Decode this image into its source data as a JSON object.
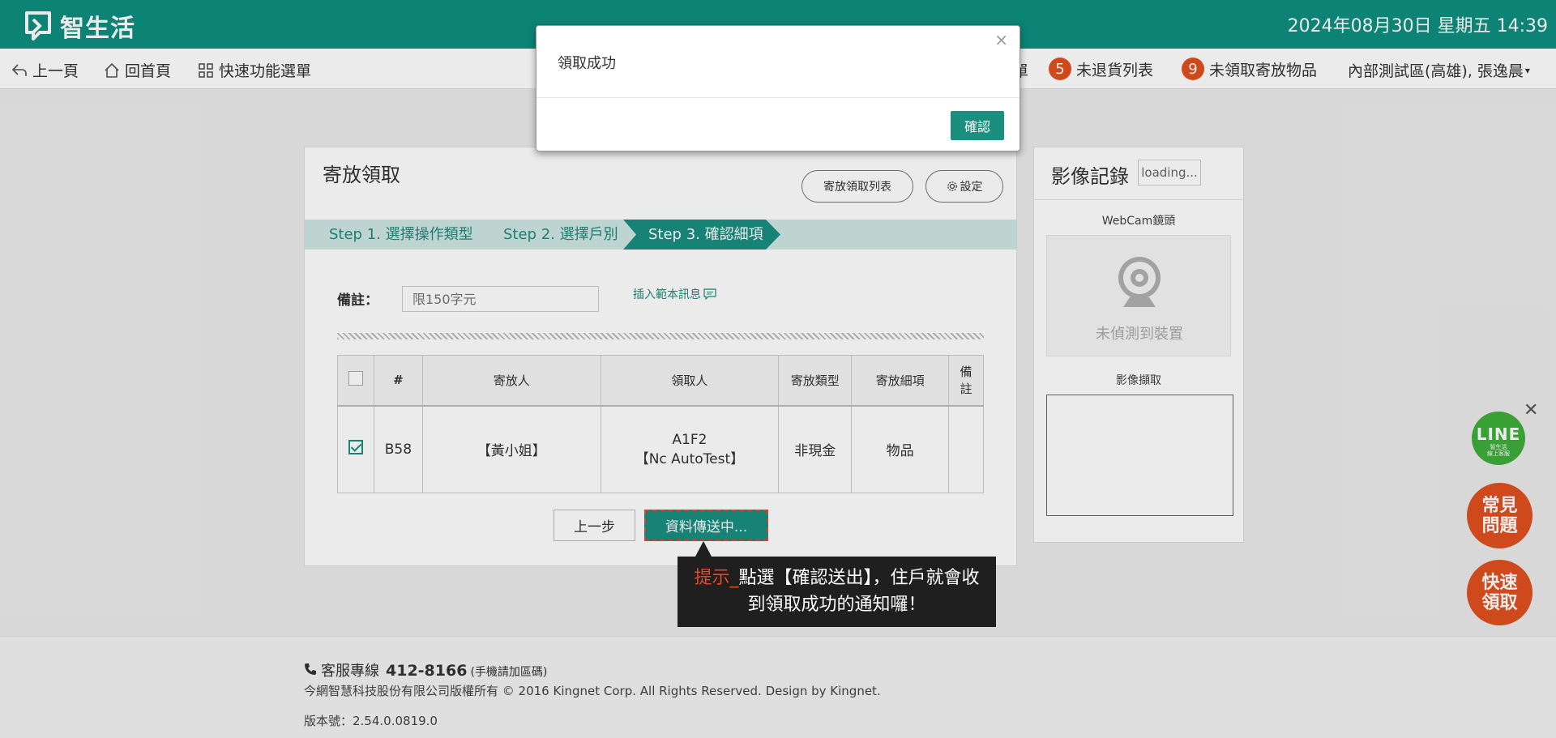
{
  "header": {
    "brand": "智生活",
    "datetime": "2024年08月30日 星期五 14:39"
  },
  "nav": {
    "back": "上一頁",
    "home": "回首頁",
    "quick_menu": "快速功能選單",
    "partial_hidden": "單",
    "unreturned_count": "5",
    "unreturned_label": "未退貨列表",
    "unclaimed_count": "9",
    "unclaimed_label": "未領取寄放物品",
    "user": "內部測試區(高雄), 張逸晨"
  },
  "main": {
    "title": "寄放領取",
    "list_button": "寄放領取列表",
    "settings_button": "設定",
    "steps": [
      {
        "label": "Step 1. 選擇操作類型"
      },
      {
        "label": "Step 2. 選擇戶別"
      },
      {
        "label": "Step 3. 確認細項"
      }
    ],
    "note_label": "備註：",
    "note_placeholder": "限150字元",
    "insert_link": "插入範本訊息",
    "table": {
      "headers": [
        "#",
        "寄放人",
        "領取人",
        "寄放類型",
        "寄放細項",
        "備註"
      ],
      "rows": [
        {
          "checked": true,
          "no": "B58",
          "sender": "【黃小姐】",
          "receiver_unit": "A1F2",
          "receiver_name": "【Nc AutoTest】",
          "type": "非現金",
          "detail": "物品",
          "note": ""
        }
      ]
    },
    "prev_button": "上一步",
    "send_button": "資料傳送中..."
  },
  "side": {
    "title": "影像記錄",
    "loading": "loading...",
    "webcam_label": "WebCam鏡頭",
    "webcam_status": "未偵測到裝置",
    "capture_label": "影像擷取"
  },
  "floating": {
    "line_big": "LINE",
    "line_small1": "智生活",
    "line_small2": "線上客服",
    "faq": "常見問題",
    "quick_claim": "快速領取"
  },
  "footer": {
    "phone_label": "客服專線",
    "phone_number": "412-8166",
    "phone_note": "(手機請加區碼)",
    "copyright": "今網智慧科技股份有限公司版權所有 © 2016 Kingnet Corp. All Rights Reserved. Design by Kingnet.",
    "version": "版本號：2.54.0.0819.0"
  },
  "modal": {
    "message": "領取成功",
    "close": "×",
    "ok": "確認"
  },
  "tooltip": {
    "hint_label": "提示_",
    "text": "點選【確認送出】，住戶就會收到領取成功的通知囉！"
  },
  "colors": {
    "brand": "#0f8f80",
    "accent_orange": "#e0501f",
    "line_green": "#3eae3a"
  }
}
